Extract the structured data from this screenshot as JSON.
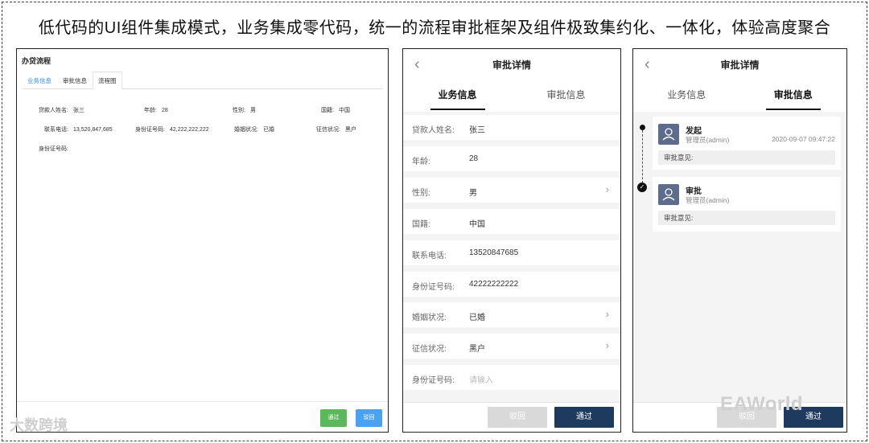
{
  "headline": "低代码的UI组件集成模式，业务集成零代码，统一的流程审批框架及组件极致集约化、一体化，体验高度聚合",
  "desktop": {
    "title": "办贷流程",
    "tabs": [
      "业务信息",
      "审批信息",
      "流程图"
    ],
    "fields": [
      {
        "label": "贷款人姓名:",
        "value": "张三"
      },
      {
        "label": "年龄:",
        "value": "28"
      },
      {
        "label": "性别:",
        "value": "男"
      },
      {
        "label": "国籍:",
        "value": "中国"
      },
      {
        "label": "联系电话:",
        "value": "13,520,847,685"
      },
      {
        "label": "身份证号码:",
        "value": "42,222,222,222"
      },
      {
        "label": "婚姻状况:",
        "value": "已婚"
      },
      {
        "label": "征信状况:",
        "value": "黑户"
      },
      {
        "label": "身份证号码:",
        "value": ""
      }
    ],
    "buttons": {
      "pass": "通过",
      "reject": "驳回"
    },
    "colors": {
      "pass": "#5cb85c",
      "reject": "#4aa3f0",
      "active_tab": "#3a8ee6"
    }
  },
  "mobile_business": {
    "title": "审批详情",
    "tabs": [
      "业务信息",
      "审批信息"
    ],
    "rows": [
      {
        "label": "贷款人姓名:",
        "value": "张三",
        "chevron": false
      },
      {
        "label": "年龄:",
        "value": "28",
        "chevron": false
      },
      {
        "label": "性别:",
        "value": "男",
        "chevron": true
      },
      {
        "label": "国籍:",
        "value": "中国",
        "chevron": false
      },
      {
        "label": "联系电话:",
        "value": "13520847685",
        "chevron": false
      },
      {
        "label": "身份证号码:",
        "value": "42222222222",
        "chevron": false
      },
      {
        "label": "婚姻状况:",
        "value": "已婚",
        "chevron": true
      },
      {
        "label": "征信状况:",
        "value": "黑户",
        "chevron": true
      },
      {
        "label": "身份证号码:",
        "placeholder": "请输入",
        "chevron": false
      }
    ],
    "buttons": {
      "reject": "驳回",
      "pass": "通过"
    }
  },
  "mobile_approval": {
    "title": "审批详情",
    "tabs": [
      "业务信息",
      "审批信息"
    ],
    "records": [
      {
        "title": "发起",
        "user": "管理员(admin)",
        "time": "2020-09-07 09:47:22",
        "opinion": "审批意见:"
      },
      {
        "title": "审批",
        "user": "管理员(admin)",
        "time": "",
        "opinion": "审批意见:"
      }
    ],
    "buttons": {
      "reject": "驳回",
      "pass": "通过"
    }
  },
  "watermarks": {
    "left": "大数跨境",
    "right": "EAWorld"
  },
  "icons": {
    "back": "chevron-left-icon",
    "row_arrow": "chevron-right-icon",
    "avatar": "user-avatar-icon",
    "done": "check-circle-icon"
  }
}
